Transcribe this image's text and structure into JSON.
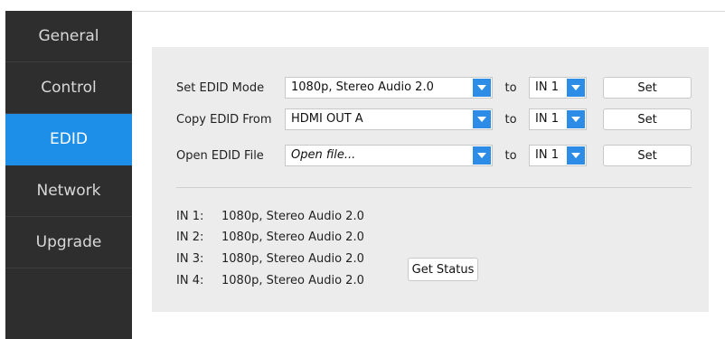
{
  "sidebar": {
    "items": [
      {
        "label": "General"
      },
      {
        "label": "Control"
      },
      {
        "label": "EDID"
      },
      {
        "label": "Network"
      },
      {
        "label": "Upgrade"
      }
    ],
    "active": "EDID"
  },
  "edid_form": {
    "rows": [
      {
        "label": "Set EDID Mode",
        "select_value": "1080p, Stereo Audio 2.0",
        "to_label": "to",
        "input_value": "IN 1",
        "button": "Set"
      },
      {
        "label": "Copy EDID From",
        "select_value": "HDMI OUT A",
        "to_label": "to",
        "input_value": "IN 1",
        "button": "Set"
      },
      {
        "label": "Open EDID File",
        "select_value": "Open file...",
        "to_label": "to",
        "input_value": "IN 1",
        "button": "Set"
      }
    ]
  },
  "status": {
    "lines": [
      {
        "port": "IN 1:",
        "value": "1080p, Stereo Audio 2.0"
      },
      {
        "port": "IN 2:",
        "value": "1080p, Stereo Audio 2.0"
      },
      {
        "port": "IN 3:",
        "value": "1080p, Stereo Audio 2.0"
      },
      {
        "port": "IN 4:",
        "value": "1080p, Stereo Audio 2.0"
      }
    ],
    "button": "Get Status"
  },
  "colors": {
    "sidebar_bg": "#2e2e2e",
    "active_accent": "#1e8fe8",
    "panel_bg": "#ececec",
    "dropdown_arrow": "#2d8ce6"
  },
  "icons": {
    "dropdown": "chevron-down-icon"
  }
}
